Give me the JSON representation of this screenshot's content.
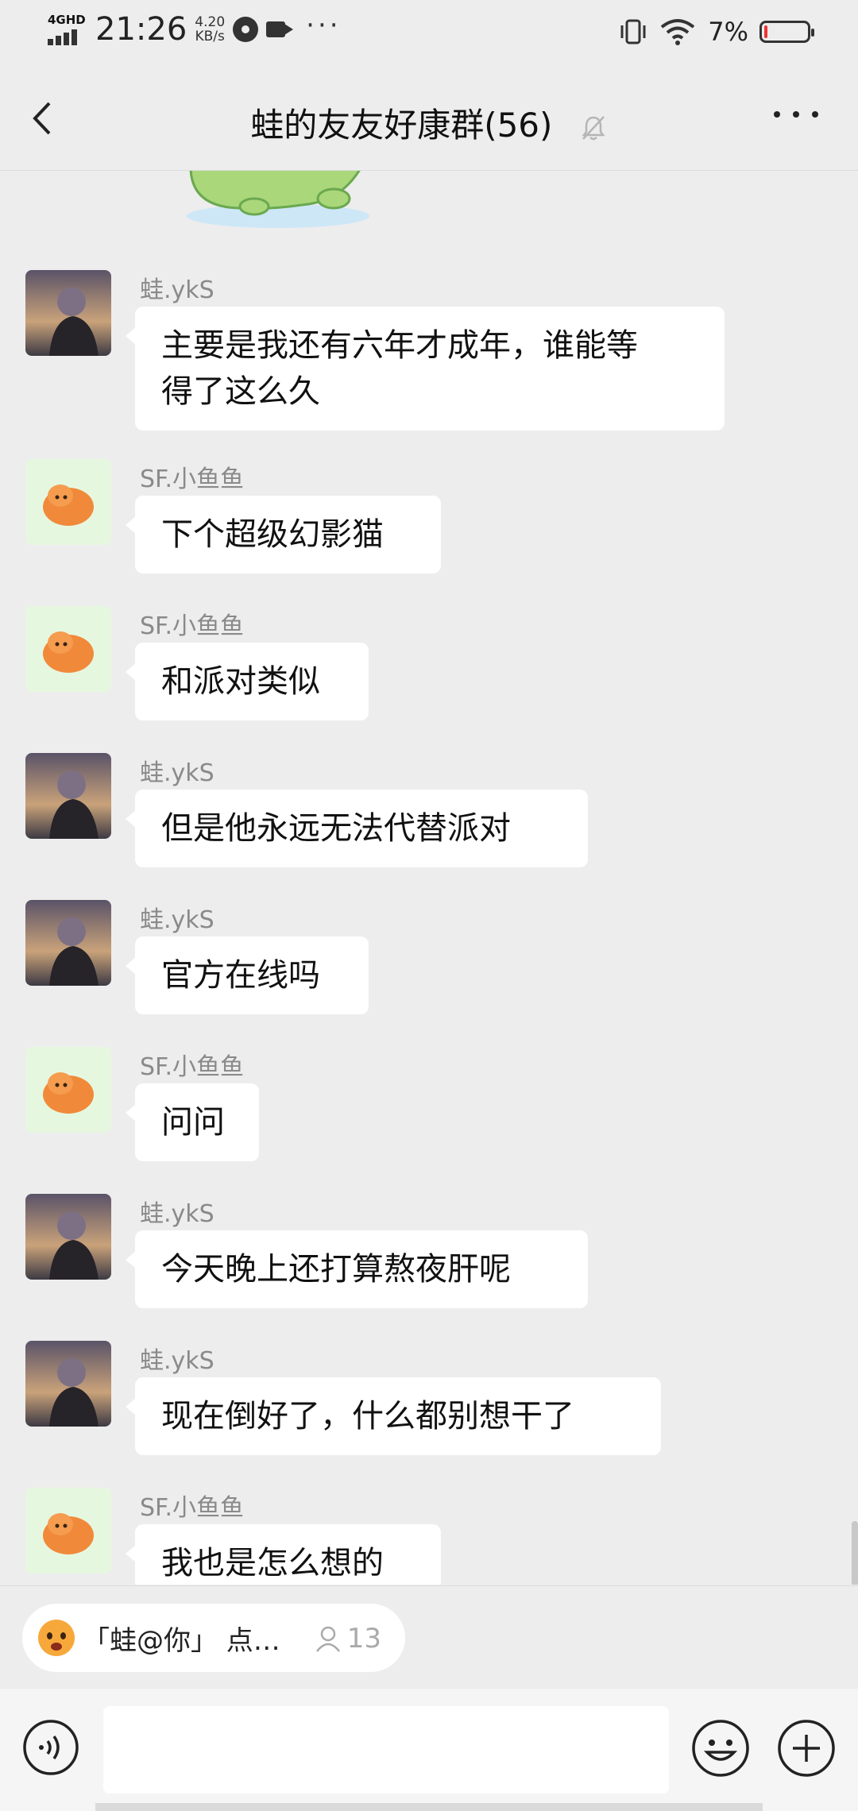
{
  "status_bar": {
    "network": "4GHD",
    "time": "21:26",
    "speed_value": "4.20",
    "speed_unit": "KB/s",
    "more": "···",
    "battery_pct": "7%",
    "battery_level": 0.07
  },
  "header": {
    "title": "蛙的友友好康群(56)",
    "more_label": "···"
  },
  "messages": [
    {
      "sender": "蛙.ykS",
      "text": "主要是我还有六年才成年，谁能等",
      "text2": "得了这么久",
      "avatar": "boy-avatar"
    },
    {
      "sender": "SF.小鱼鱼",
      "text": "下个超级幻影猫",
      "avatar": "orange-cat-avatar"
    },
    {
      "sender": "SF.小鱼鱼",
      "text": "和派对类似",
      "avatar": "orange-cat-avatar"
    },
    {
      "sender": "蛙.ykS",
      "text": "但是他永远无法代替派对",
      "avatar": "boy-avatar"
    },
    {
      "sender": "蛙.ykS",
      "text": "官方在线吗",
      "avatar": "boy-avatar"
    },
    {
      "sender": "SF.小鱼鱼",
      "text": "问问",
      "avatar": "orange-cat-avatar"
    },
    {
      "sender": "蛙.ykS",
      "text": "今天晚上还打算熬夜肝呢",
      "avatar": "boy-avatar"
    },
    {
      "sender": "蛙.ykS",
      "text": "现在倒好了，什么都别想干了",
      "avatar": "boy-avatar"
    },
    {
      "sender": "SF.小鱼鱼",
      "text": "我也是怎么想的",
      "avatar": "orange-cat-avatar"
    }
  ],
  "mention": {
    "text": "「蛙@你」 点…",
    "count": "13"
  },
  "icons": {
    "back": "chevron-left-icon",
    "mute": "bell-muted-icon",
    "voice": "voice-icon",
    "emoji": "emoji-icon",
    "add": "add-icon"
  }
}
